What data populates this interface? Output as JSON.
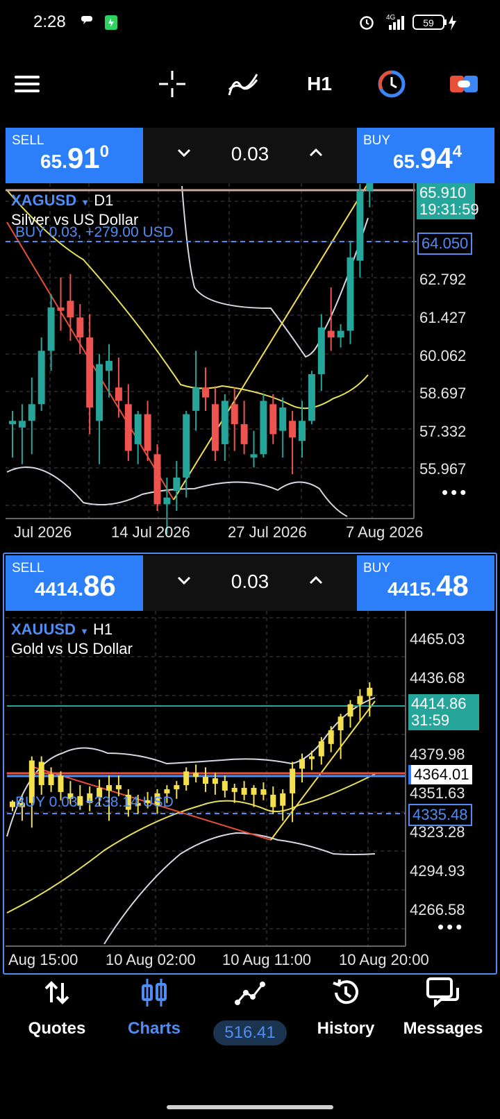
{
  "status_bar": {
    "time": "2:28",
    "network": "4G",
    "battery": "59"
  },
  "toolbar": {
    "menu_icon": "menu-icon",
    "crosshair_icon": "crosshair-icon",
    "indicators_icon": "indicators-icon",
    "timeframe": "H1",
    "clock_icon": "clock-icon",
    "trade_icon": "trade-icon"
  },
  "chart1": {
    "symbol": "XAGUSD",
    "timeframe": "D1",
    "description": "Silver vs US Dollar",
    "position_label": "BUY 0.03,  +279.00 USD",
    "trade": {
      "sell_label": "SELL",
      "sell_small": "65.",
      "sell_big": "91",
      "sell_sup": "0",
      "volume": "0.03",
      "buy_label": "BUY",
      "buy_small": "65.",
      "buy_big": "94",
      "buy_sup": "4"
    },
    "price_tag": "65.910",
    "countdown": "19:31:59",
    "entry_tag": "64.050",
    "price_axis": [
      "62.792",
      "61.427",
      "60.062",
      "58.697",
      "57.332",
      "55.967"
    ],
    "time_axis": [
      "Jul 2026",
      "14 Jul 2026",
      "27 Jul 2026",
      "7 Aug 2026"
    ],
    "more": "•••"
  },
  "chart2": {
    "symbol": "XAUUSD",
    "timeframe": "H1",
    "description": "Gold vs US Dollar",
    "position_label": "BUY 0.03,  +238.14 USD",
    "trade": {
      "sell_label": "SELL",
      "sell_small": "4414.",
      "sell_big": "86",
      "volume": "0.03",
      "buy_label": "BUY",
      "buy_small": "4415.",
      "buy_big": "48"
    },
    "price_tag": "4414.86",
    "countdown": "31:59",
    "alert_tag": "4364.01",
    "entry_tag": "4335.48",
    "price_axis": [
      "4465.03",
      "4436.68",
      "4379.98",
      "4351.63",
      "4323.28",
      "4294.93",
      "4266.58"
    ],
    "time_axis": [
      "Aug 15:00",
      "10 Aug 02:00",
      "10 Aug 11:00",
      "10 Aug 20:00"
    ],
    "more": "•••"
  },
  "nav": {
    "quotes": "Quotes",
    "charts": "Charts",
    "balance": "516.41",
    "history": "History",
    "messages": "Messages"
  },
  "colors": {
    "buy_blue": "#2d7ff9",
    "accent_blue": "#4f8df5",
    "bull_silver": "#26a69a",
    "bear_silver": "#ef5350",
    "gold_candle": "#f4e04d",
    "teal_tag": "#26a69a"
  },
  "candles_silver": [
    [
      58.4,
      58.8,
      57.4,
      58.5
    ],
    [
      58.3,
      59.0,
      57.2,
      58.5
    ],
    [
      58.5,
      59.8,
      57.5,
      59.0
    ],
    [
      59.0,
      61.0,
      58.8,
      60.6
    ],
    [
      60.6,
      62.3,
      60.0,
      61.9
    ],
    [
      61.9,
      62.8,
      61.2,
      61.8
    ],
    [
      62.1,
      62.9,
      60.9,
      61.6
    ],
    [
      61.6,
      62.0,
      60.5,
      61.0
    ],
    [
      61.0,
      61.7,
      58.1,
      58.9
    ],
    [
      58.5,
      60.5,
      57.2,
      60.2
    ],
    [
      60.0,
      60.8,
      59.2,
      60.3
    ],
    [
      59.5,
      60.4,
      58.6,
      59.1
    ],
    [
      59.0,
      59.6,
      57.3,
      57.6
    ],
    [
      57.8,
      58.8,
      57.2,
      58.7
    ],
    [
      58.7,
      59.1,
      57.3,
      57.6
    ],
    [
      57.5,
      57.8,
      55.8,
      56.0
    ],
    [
      56.0,
      56.8,
      55.1,
      56.2
    ],
    [
      56.4,
      57.3,
      55.8,
      56.8
    ],
    [
      56.8,
      58.8,
      56.2,
      58.7
    ],
    [
      58.8,
      60.6,
      58.2,
      59.5
    ],
    [
      59.5,
      60.1,
      58.8,
      59.2
    ],
    [
      59.0,
      59.5,
      57.3,
      57.6
    ],
    [
      57.8,
      59.3,
      57.3,
      59.1
    ],
    [
      59.0,
      59.5,
      57.6,
      58.4
    ],
    [
      58.4,
      59.1,
      57.5,
      57.8
    ],
    [
      57.4,
      58.2,
      57.1,
      57.5
    ],
    [
      57.5,
      59.3,
      57.4,
      59.1
    ],
    [
      59.0,
      59.3,
      57.8,
      58.1
    ],
    [
      58.2,
      59.2,
      57.4,
      58.9
    ],
    [
      58.5,
      58.8,
      56.9,
      58.0
    ],
    [
      57.9,
      59.1,
      57.4,
      58.5
    ],
    [
      58.5,
      60.0,
      58.4,
      59.9
    ],
    [
      59.9,
      61.7,
      59.4,
      61.3
    ],
    [
      61.2,
      62.5,
      60.6,
      61.0
    ],
    [
      61.0,
      61.4,
      60.7,
      61.2
    ],
    [
      61.2,
      63.9,
      60.8,
      63.4
    ],
    [
      63.3,
      65.6,
      62.8,
      65.4
    ],
    [
      65.4,
      66.3,
      64.9,
      65.9
    ]
  ],
  "candles_gold": [
    [
      4331,
      4332,
      4324,
      4327
    ],
    [
      4327,
      4335,
      4317,
      4330
    ],
    [
      4330,
      4364,
      4312,
      4361
    ],
    [
      4360,
      4364,
      4336,
      4343
    ],
    [
      4343,
      4356,
      4338,
      4351
    ],
    [
      4350,
      4353,
      4332,
      4338
    ],
    [
      4337,
      4346,
      4329,
      4333
    ],
    [
      4335,
      4343,
      4325,
      4328
    ],
    [
      4330,
      4342,
      4324,
      4337
    ],
    [
      4334,
      4347,
      4328,
      4341
    ],
    [
      4339,
      4350,
      4317,
      4343
    ],
    [
      4343,
      4350,
      4335,
      4340
    ],
    [
      4336,
      4340,
      4320,
      4325
    ],
    [
      4328,
      4336,
      4322,
      4330
    ],
    [
      4330,
      4338,
      4326,
      4332
    ],
    [
      4328,
      4340,
      4322,
      4337
    ],
    [
      4337,
      4343,
      4330,
      4340
    ],
    [
      4340,
      4346,
      4333,
      4343
    ],
    [
      4343,
      4356,
      4339,
      4353
    ],
    [
      4352,
      4358,
      4345,
      4349
    ],
    [
      4349,
      4356,
      4338,
      4344
    ],
    [
      4344,
      4352,
      4336,
      4348
    ],
    [
      4346,
      4350,
      4334,
      4339
    ],
    [
      4338,
      4344,
      4330,
      4341
    ],
    [
      4341,
      4346,
      4332,
      4336
    ],
    [
      4336,
      4343,
      4327,
      4341
    ],
    [
      4340,
      4345,
      4332,
      4336
    ],
    [
      4336,
      4342,
      4322,
      4327
    ],
    [
      4328,
      4340,
      4317,
      4337
    ],
    [
      4337,
      4360,
      4316,
      4355
    ],
    [
      4355,
      4366,
      4345,
      4362
    ],
    [
      4362,
      4368,
      4354,
      4364
    ],
    [
      4364,
      4378,
      4358,
      4375
    ],
    [
      4373,
      4386,
      4367,
      4383
    ],
    [
      4383,
      4395,
      4362,
      4393
    ],
    [
      4393,
      4405,
      4385,
      4402
    ],
    [
      4402,
      4413,
      4390,
      4408
    ],
    [
      4408,
      4418,
      4393,
      4414
    ]
  ]
}
